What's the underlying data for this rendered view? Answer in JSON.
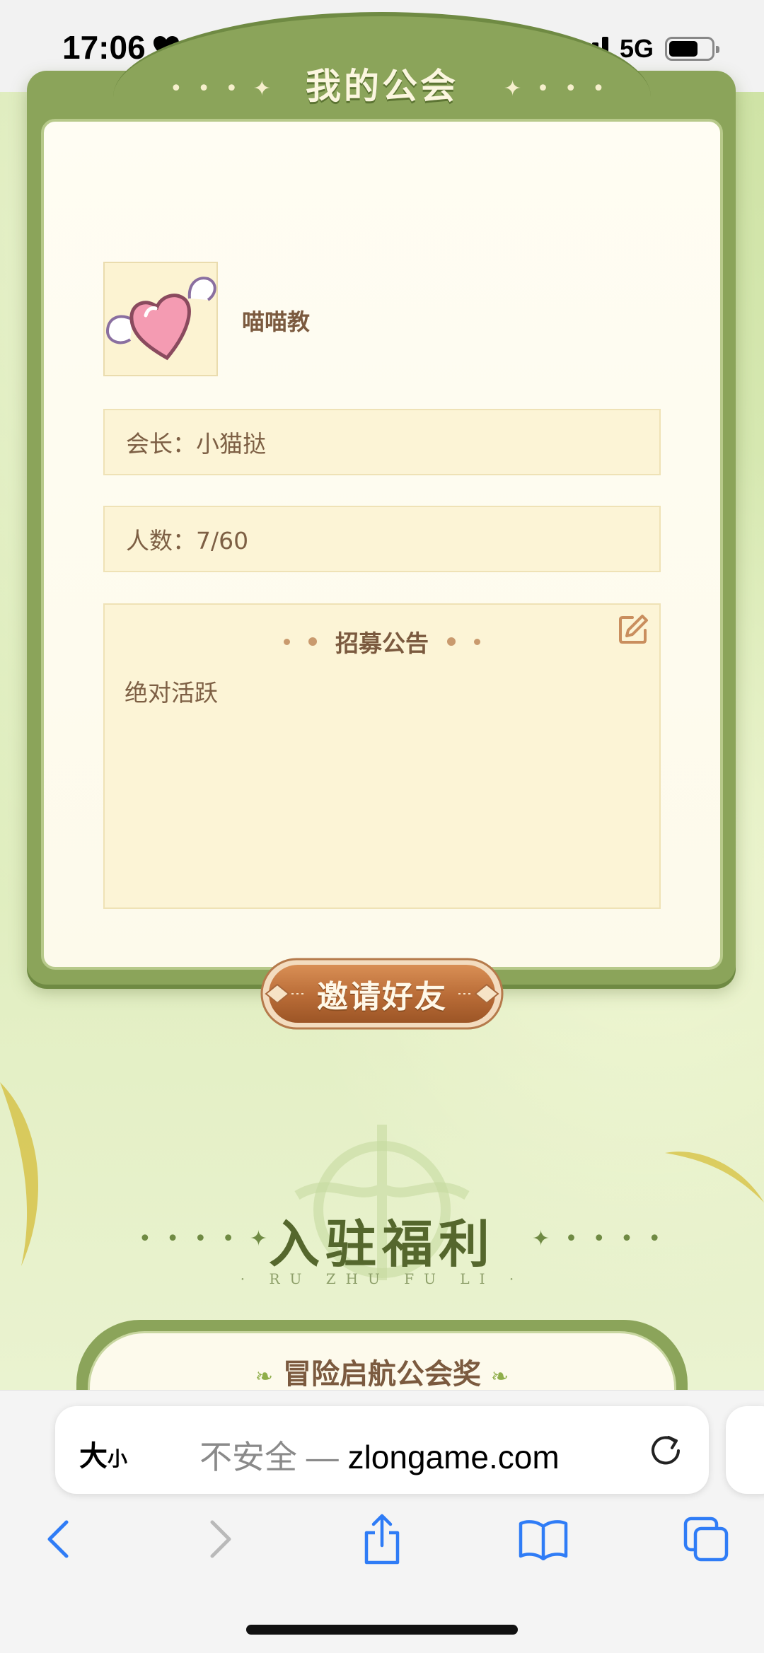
{
  "status_bar": {
    "time": "17:06",
    "network": "5G"
  },
  "guild_panel": {
    "title": "我的公会",
    "guild_name": "喵喵教",
    "leader": "会长：小猫挞",
    "members": "人数：7/60",
    "notice": {
      "title": "招募公告",
      "text": "绝对活跃"
    },
    "invite_button": "邀请好友"
  },
  "benefits": {
    "title": "入驻福利",
    "subtitle": "· RU ZHU FU LI ·",
    "first_card_title": "冒险启航公会奖"
  },
  "browser": {
    "text_size_large": "大",
    "text_size_small": "小",
    "security_label": "不安全 — ",
    "domain": "zlongame.com"
  },
  "colors": {
    "panel_green": "#8ba45a",
    "paper": "#fcf4d6",
    "brown_text": "#7b5a3f",
    "invite_button": "#c67a43",
    "ios_blue": "#2f7cf6"
  }
}
